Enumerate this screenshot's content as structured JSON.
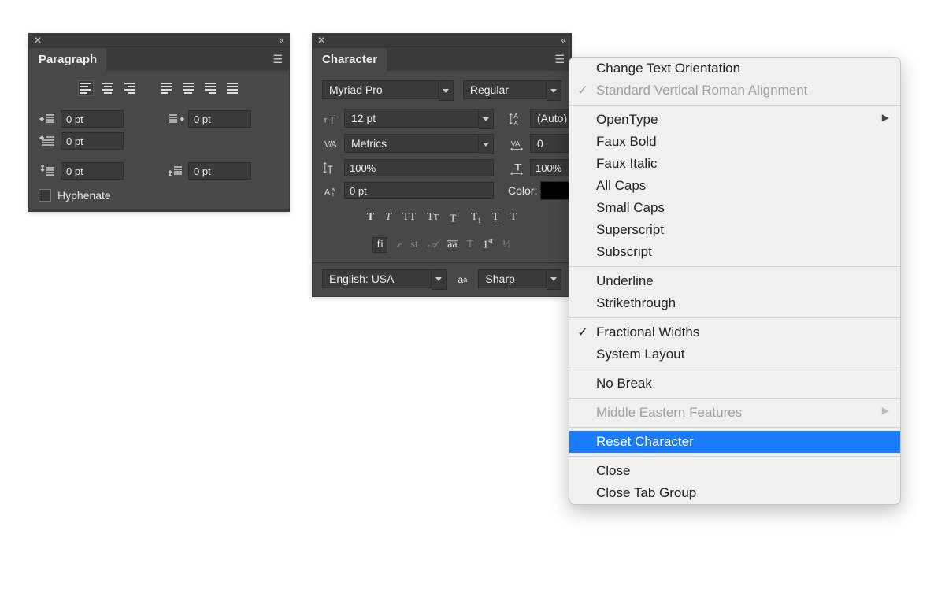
{
  "paragraph": {
    "title": "Paragraph",
    "indent_left": "0 pt",
    "indent_right": "0 pt",
    "first_line": "0 pt",
    "space_before": "0 pt",
    "space_after": "0 pt",
    "hyphenate_label": "Hyphenate"
  },
  "character": {
    "title": "Character",
    "font_family": "Myriad Pro",
    "font_style": "Regular",
    "size": "12 pt",
    "leading": "(Auto)",
    "kerning": "Metrics",
    "tracking": "0",
    "vscale": "100%",
    "hscale": "100%",
    "baseline": "0 pt",
    "color_label": "Color:",
    "language": "English: USA",
    "antialias": "Sharp"
  },
  "menu": {
    "items": [
      {
        "label": "Change Text Orientation",
        "type": "item"
      },
      {
        "label": "Standard Vertical Roman Alignment",
        "type": "item",
        "disabled": true,
        "check": true
      },
      {
        "type": "sep"
      },
      {
        "label": "OpenType",
        "type": "sub"
      },
      {
        "label": "Faux Bold",
        "type": "item"
      },
      {
        "label": "Faux Italic",
        "type": "item"
      },
      {
        "label": "All Caps",
        "type": "item"
      },
      {
        "label": "Small Caps",
        "type": "item"
      },
      {
        "label": "Superscript",
        "type": "item"
      },
      {
        "label": "Subscript",
        "type": "item"
      },
      {
        "type": "sep"
      },
      {
        "label": "Underline",
        "type": "item"
      },
      {
        "label": "Strikethrough",
        "type": "item"
      },
      {
        "type": "sep"
      },
      {
        "label": "Fractional Widths",
        "type": "item",
        "check": true
      },
      {
        "label": "System Layout",
        "type": "item"
      },
      {
        "type": "sep"
      },
      {
        "label": "No Break",
        "type": "item"
      },
      {
        "type": "sep"
      },
      {
        "label": "Middle Eastern Features",
        "type": "sub",
        "disabled": true
      },
      {
        "type": "sep"
      },
      {
        "label": "Reset Character",
        "type": "item",
        "hover": true
      },
      {
        "type": "sep"
      },
      {
        "label": "Close",
        "type": "item"
      },
      {
        "label": "Close Tab Group",
        "type": "item"
      }
    ]
  }
}
